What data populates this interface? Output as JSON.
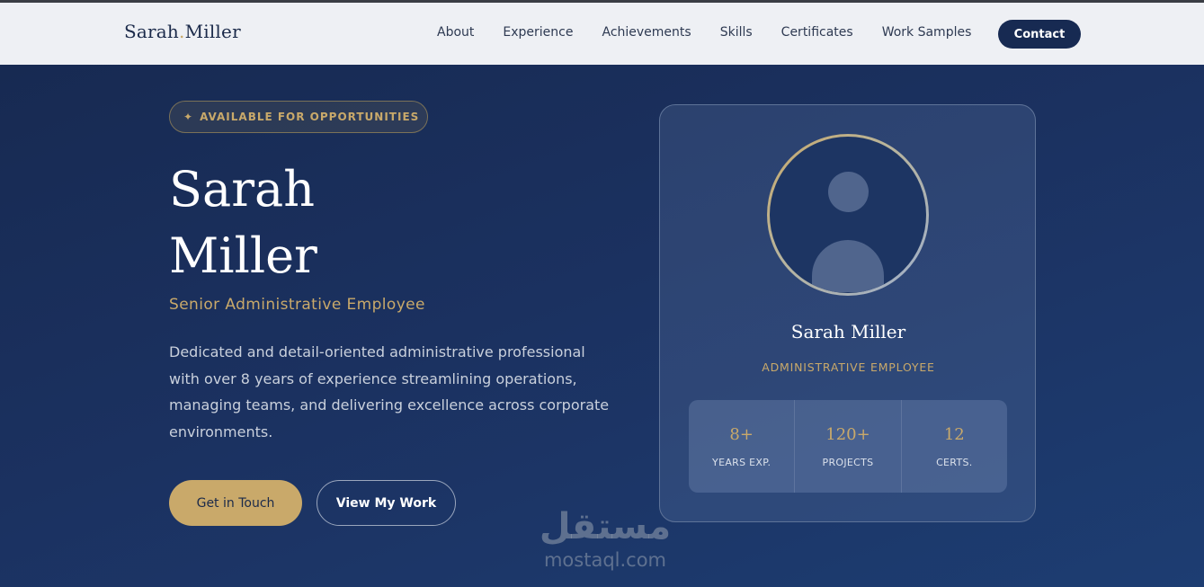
{
  "brand": {
    "first": "Sarah",
    "last": "Miller"
  },
  "nav": {
    "links": [
      "About",
      "Experience",
      "Achievements",
      "Skills",
      "Certificates",
      "Work Samples"
    ],
    "contact_label": "Contact"
  },
  "hero": {
    "badge": "AVAILABLE FOR OPPORTUNITIES",
    "name_line1": "Sarah",
    "name_line2": "Miller",
    "role": "Senior Administrative Employee",
    "description": "Dedicated and detail-oriented administrative professional with over 8 years of experience streamlining operations, managing teams, and delivering excellence across corporate environments.",
    "primary_button": "Get in Touch",
    "secondary_button": "View My Work"
  },
  "profile_card": {
    "name": "Sarah Miller",
    "role": "ADMINISTRATIVE EMPLOYEE",
    "stats": [
      {
        "value": "8+",
        "label": "YEARS EXP."
      },
      {
        "value": "120+",
        "label": "PROJECTS"
      },
      {
        "value": "12",
        "label": "CERTS."
      }
    ]
  },
  "watermark": {
    "arabic": "مستقل",
    "latin": "mostaql.com"
  },
  "colors": {
    "accent_gold": "#c9a96a",
    "navy": "#172a52",
    "navbar_bg": "#eef0f4"
  }
}
